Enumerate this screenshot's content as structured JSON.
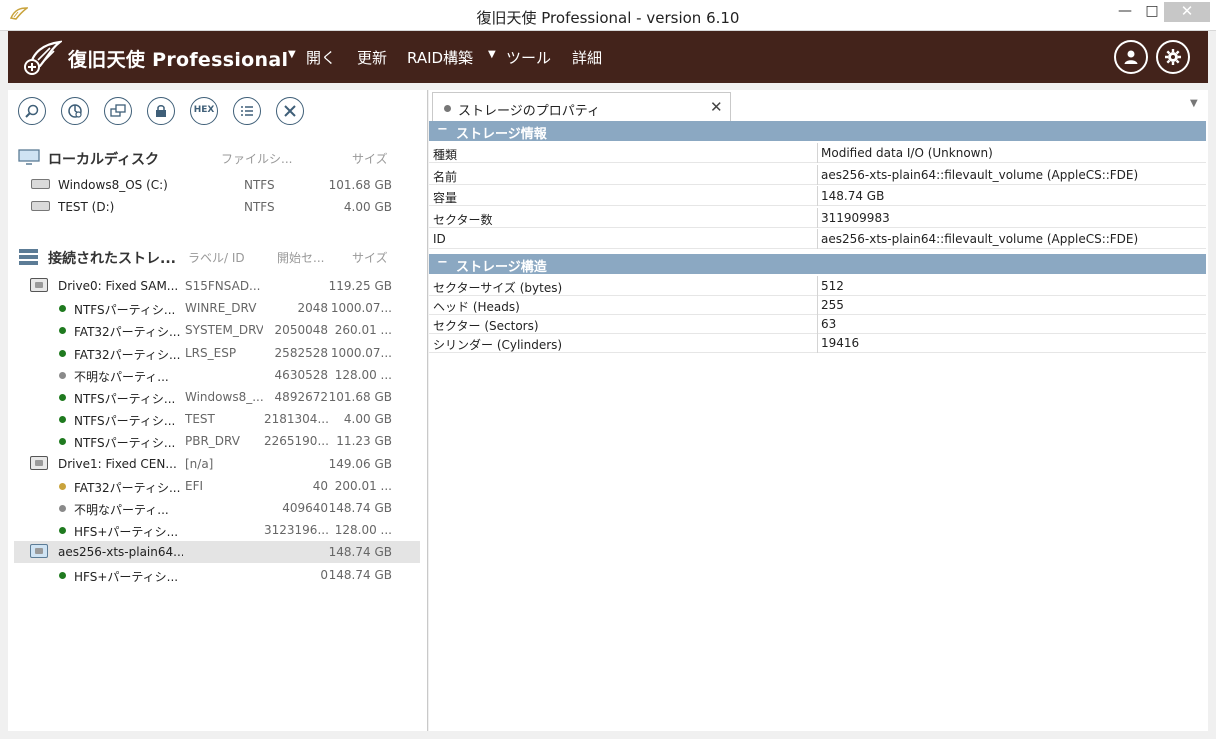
{
  "window": {
    "title": "復旧天使 Professional - version 6.10",
    "controls": {
      "minimize": "—",
      "maximize": "□",
      "close": "✕"
    }
  },
  "menubar": {
    "brand": "復旧天使 Professional",
    "items": [
      "開く",
      "更新",
      "RAID構築",
      "ツール",
      "詳細"
    ],
    "colors": {
      "background": "#43231b"
    }
  },
  "toolbar": {
    "hex_label": "HEX",
    "icons": [
      "search-icon",
      "pie-chart-icon",
      "drives-icon",
      "lock-icon",
      "hex-icon",
      "list-icon",
      "close-icon"
    ]
  },
  "local_disks": {
    "title": "ローカルディスク",
    "columns": [
      "ファイルシ...",
      "サイズ"
    ],
    "items": [
      {
        "name": "Windows8_OS (C:)",
        "fs": "NTFS",
        "size": "101.68 GB"
      },
      {
        "name": "TEST (D:)",
        "fs": "NTFS",
        "size": "4.00 GB"
      }
    ]
  },
  "connected": {
    "title": "接続されたストレ...",
    "columns": [
      "ラベル/ ID",
      "開始セ...",
      "サイズ"
    ],
    "rows": [
      {
        "name": "Drive0: Fixed SAM...",
        "label": "S15FNSAD...",
        "start": "",
        "size": "119.25 GB",
        "kind": "drive"
      },
      {
        "name": "NTFSパーティシ...",
        "label": "WINRE_DRV",
        "start": "2048",
        "size": "1000.07...",
        "kind": "part",
        "status": "green"
      },
      {
        "name": "FAT32パーティシ...",
        "label": "SYSTEM_DRV",
        "start": "2050048",
        "size": "260.01 ...",
        "kind": "part",
        "status": "green"
      },
      {
        "name": "FAT32パーティシ...",
        "label": "LRS_ESP",
        "start": "2582528",
        "size": "1000.07...",
        "kind": "part",
        "status": "green"
      },
      {
        "name": "不明なパーティ...",
        "label": "",
        "start": "4630528",
        "size": "128.00 ...",
        "kind": "part",
        "status": "gray"
      },
      {
        "name": "NTFSパーティシ...",
        "label": "Windows8_...",
        "start": "4892672",
        "size": "101.68 GB",
        "kind": "part",
        "status": "green"
      },
      {
        "name": "NTFSパーティシ...",
        "label": "TEST",
        "start": "2181304...",
        "size": "4.00 GB",
        "kind": "part",
        "status": "green"
      },
      {
        "name": "NTFSパーティシ...",
        "label": "PBR_DRV",
        "start": "2265190...",
        "size": "11.23 GB",
        "kind": "part",
        "status": "green"
      },
      {
        "name": "Drive1: Fixed CEN...",
        "label": "[n/a]",
        "start": "",
        "size": "149.06 GB",
        "kind": "drive"
      },
      {
        "name": "FAT32パーティシ...",
        "label": "EFI",
        "start": "40",
        "size": "200.01 ...",
        "kind": "part",
        "status": "gold"
      },
      {
        "name": "不明なパーティ...",
        "label": "",
        "start": "409640",
        "size": "148.74 GB",
        "kind": "part",
        "status": "gray"
      },
      {
        "name": "HFS+パーティシ...",
        "label": "",
        "start": "3123196...",
        "size": "128.00 ...",
        "kind": "part",
        "status": "green"
      },
      {
        "name": "aes256-xts-plain64...",
        "label": "",
        "start": "",
        "size": "148.74 GB",
        "kind": "volume",
        "selected": true
      },
      {
        "name": "HFS+パーティシ...",
        "label": "",
        "start": "0",
        "size": "148.74 GB",
        "kind": "part",
        "status": "green"
      }
    ]
  },
  "properties": {
    "tab_title": "ストレージのプロパティ",
    "sections": [
      {
        "title": "ストレージ情報",
        "rows": [
          {
            "key": "種類",
            "value": "Modified data I/O (Unknown)"
          },
          {
            "key": "名前",
            "value": "aes256-xts-plain64::filevault_volume (AppleCS::FDE)"
          },
          {
            "key": "容量",
            "value": "148.74 GB"
          },
          {
            "key": "セクター数",
            "value": "311909983"
          },
          {
            "key": "ID",
            "value": "aes256-xts-plain64::filevault_volume (AppleCS::FDE)"
          }
        ]
      },
      {
        "title": "ストレージ構造",
        "rows": [
          {
            "key": "セクターサイズ (bytes)",
            "value": "512"
          },
          {
            "key": "ヘッド (Heads)",
            "value": "255"
          },
          {
            "key": "セクター (Sectors)",
            "value": "63"
          },
          {
            "key": "シリンダー (Cylinders)",
            "value": "19416"
          }
        ]
      }
    ]
  }
}
